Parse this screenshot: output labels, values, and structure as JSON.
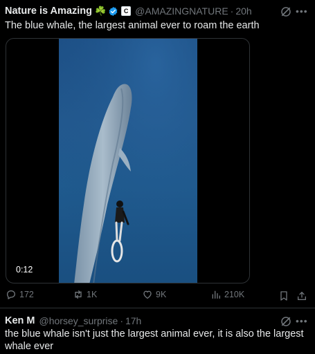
{
  "tweets": [
    {
      "display_name": "Nature is Amazing",
      "emoji": "☘️",
      "affiliate_badge": "C",
      "handle": "@AMAZINGNATURE",
      "separator": "·",
      "time": "20h",
      "text": "The blue whale, the largest animal ever to roam the earth",
      "media": {
        "type": "video",
        "duration": "0:12"
      },
      "actions": {
        "replies": "172",
        "reposts": "1K",
        "likes": "9K",
        "views": "210K"
      }
    },
    {
      "display_name": "Ken M",
      "handle": "@horsey_surprise",
      "separator": "·",
      "time": "17h",
      "text": "the blue whale isn't just the largest animal ever, it is also the largest whale ever"
    }
  ],
  "icons": {
    "verified": "verified-badge-icon",
    "grok": "grok-icon",
    "more": "more-icon",
    "reply": "reply-icon",
    "repost": "repost-icon",
    "like": "heart-icon",
    "views": "views-icon",
    "bookmark": "bookmark-icon",
    "share": "share-icon"
  },
  "colors": {
    "background": "#000000",
    "text": "#e7e9ea",
    "secondary": "#71767b",
    "verified": "#1d9bf0",
    "border": "#2f3336",
    "water": "#1f5a8e"
  }
}
